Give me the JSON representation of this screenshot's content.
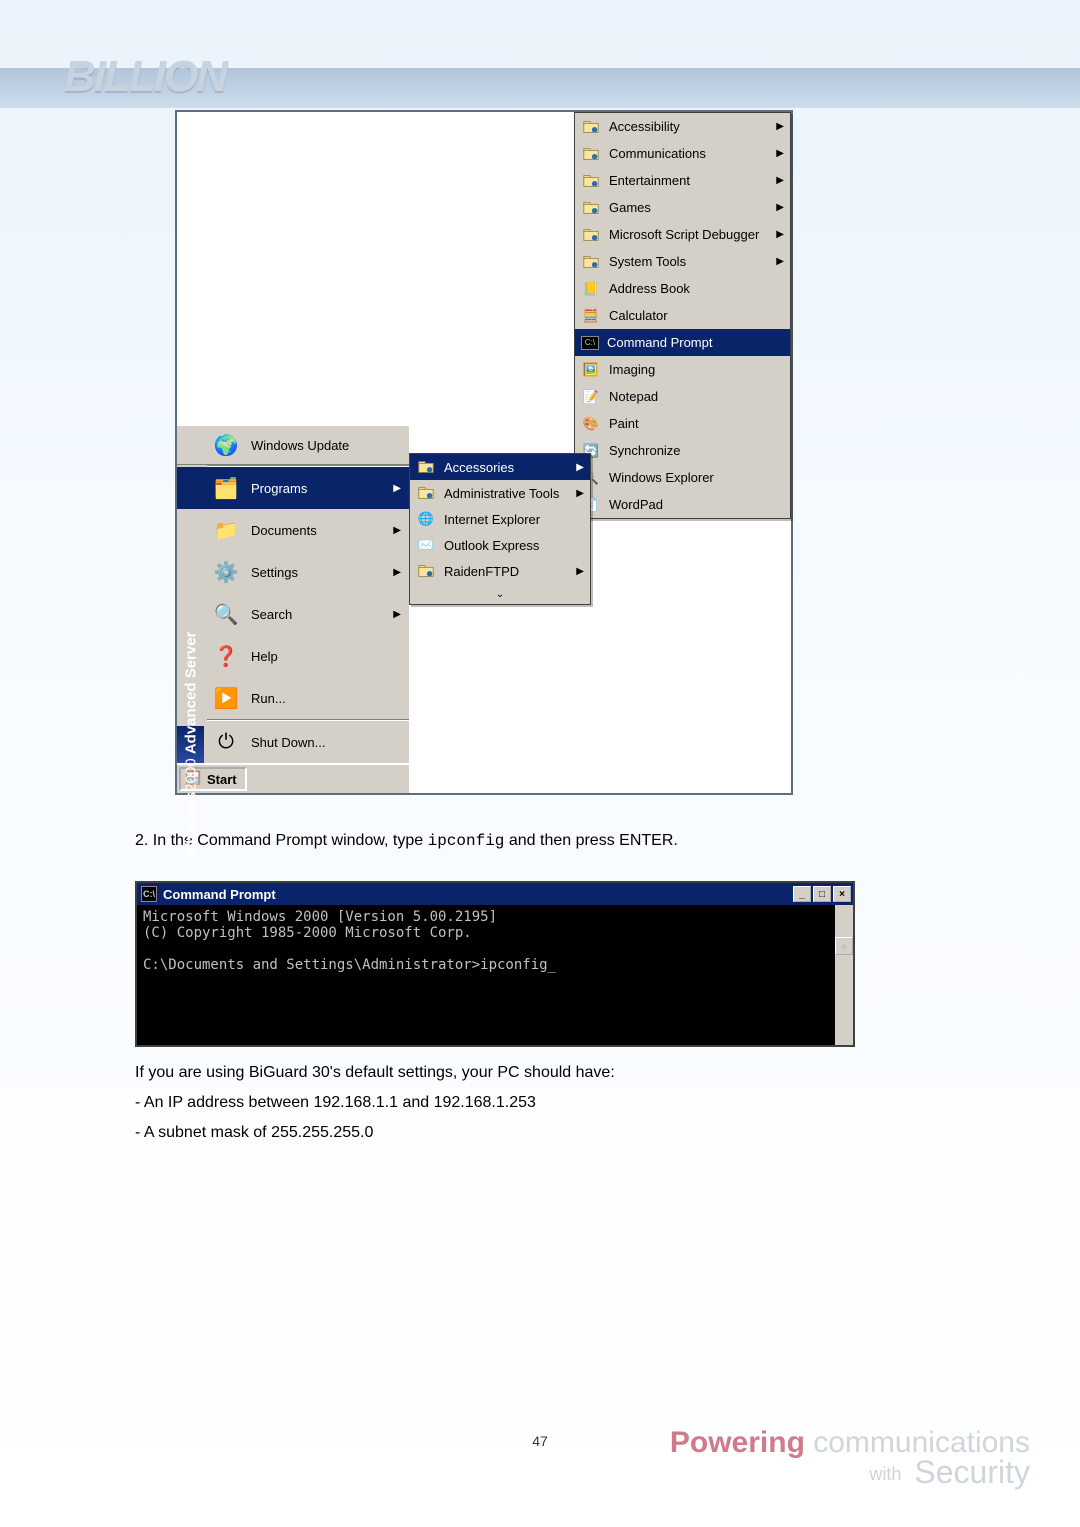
{
  "header": {
    "logo_text": "BILLION"
  },
  "startmenu": {
    "brand_html": "Windows 2000 Advanced Server",
    "update_label": "Windows Update",
    "items": [
      {
        "label": "Programs",
        "arrow": true,
        "selected": true
      },
      {
        "label": "Documents",
        "arrow": true
      },
      {
        "label": "Settings",
        "arrow": true
      },
      {
        "label": "Search",
        "arrow": true
      },
      {
        "label": "Help"
      },
      {
        "label": "Run..."
      }
    ],
    "shutdown_label": "Shut Down...",
    "start_label": "Start"
  },
  "programs_menu": {
    "items": [
      {
        "label": "Accessories",
        "arrow": true,
        "selected": true
      },
      {
        "label": "Administrative Tools",
        "arrow": true
      },
      {
        "label": "Internet Explorer"
      },
      {
        "label": "Outlook Express"
      },
      {
        "label": "RaidenFTPD",
        "arrow": true
      }
    ]
  },
  "accessories_menu": {
    "items": [
      {
        "label": "Accessibility",
        "arrow": true
      },
      {
        "label": "Communications",
        "arrow": true
      },
      {
        "label": "Entertainment",
        "arrow": true
      },
      {
        "label": "Games",
        "arrow": true
      },
      {
        "label": "Microsoft Script Debugger",
        "arrow": true
      },
      {
        "label": "System Tools",
        "arrow": true
      },
      {
        "label": "Address Book"
      },
      {
        "label": "Calculator"
      },
      {
        "label": "Command Prompt",
        "selected": true
      },
      {
        "label": "Imaging"
      },
      {
        "label": "Notepad"
      },
      {
        "label": "Paint"
      },
      {
        "label": "Synchronize"
      },
      {
        "label": "Windows Explorer"
      },
      {
        "label": "WordPad"
      }
    ]
  },
  "step2": {
    "prefix": "2. In the Command Prompt window, type ",
    "cmd": "ipconfig",
    "suffix": " and then press ENTER."
  },
  "cmd": {
    "title": "Command Prompt",
    "line1": "Microsoft Windows 2000 [Version 5.00.2195]",
    "line2": "(C) Copyright 1985-2000 Microsoft Corp.",
    "prompt": "C:\\Documents and Settings\\Administrator>ipconfig_"
  },
  "notes": {
    "line1": "If you are using BiGuard 30's default settings, your PC should have:",
    "line2": "- An IP address between 192.168.1.1 and 192.168.1.253",
    "line3": "- A subnet mask of 255.255.255.0"
  },
  "page_number": "47",
  "footer": {
    "powering": "Powering",
    "communications": " communications",
    "with": "with ",
    "security": "Security"
  }
}
